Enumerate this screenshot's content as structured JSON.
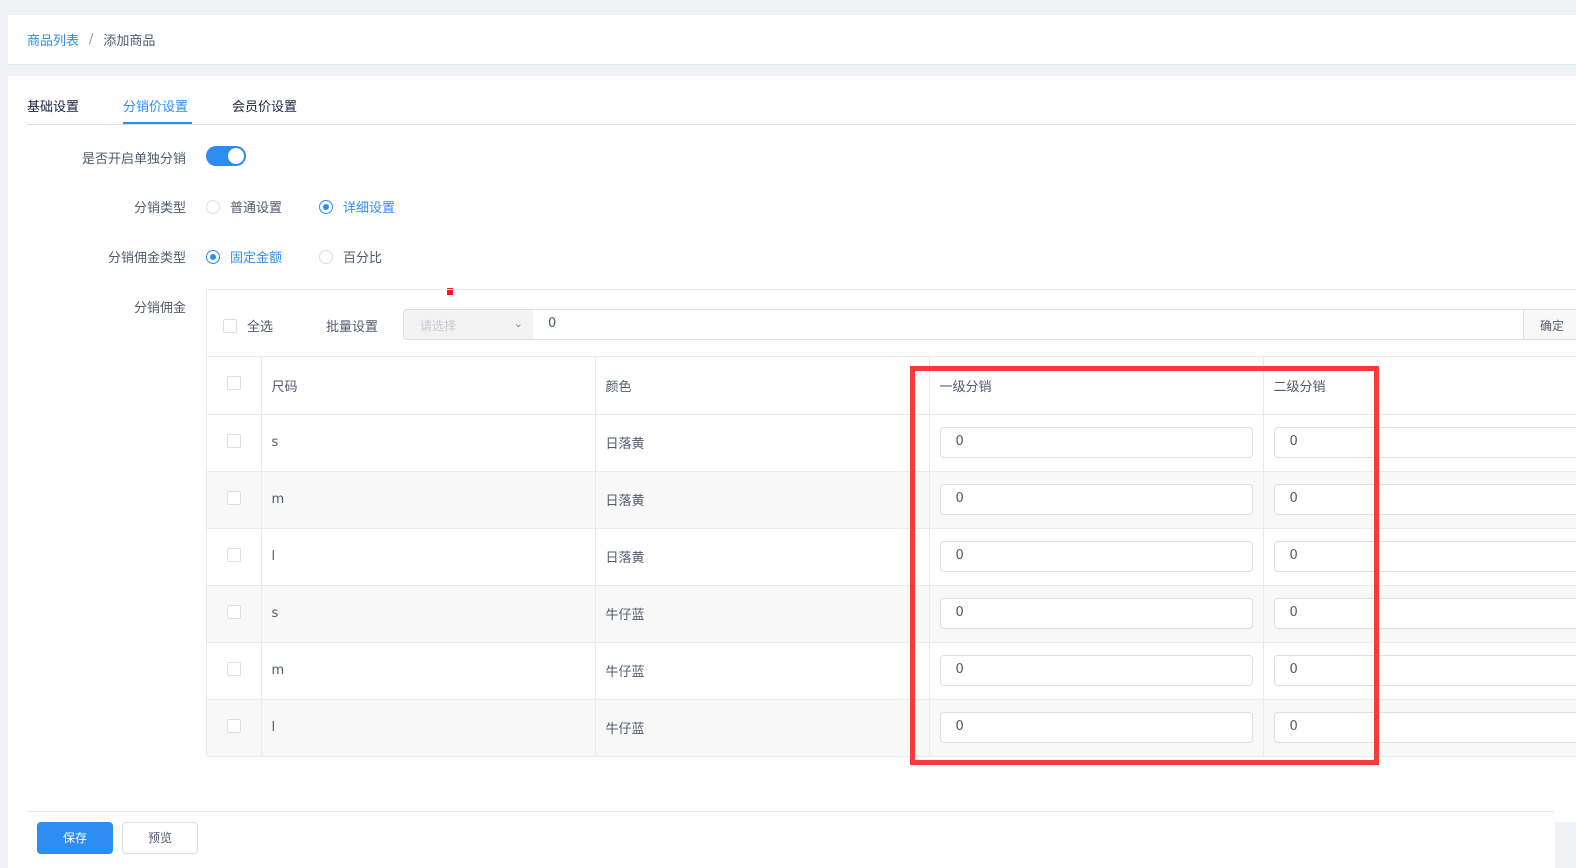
{
  "breadcrumb": {
    "parent": "商品列表",
    "separator": "/",
    "current": "添加商品"
  },
  "tabs": [
    {
      "label": "基础设置"
    },
    {
      "label": "分销价设置"
    },
    {
      "label": "会员价设置"
    }
  ],
  "active_tab": "分销价设置",
  "form": {
    "switch_label": "是否开启单独分销",
    "switch_on": true,
    "dist_type_label": "分销类型",
    "dist_type_options": [
      "普通设置",
      "详细设置"
    ],
    "dist_type_selected": "详细设置",
    "commission_type_label": "分销佣金类型",
    "commission_type_options": [
      "固定金额",
      "百分比"
    ],
    "commission_type_selected": "固定金额",
    "commission_label": "分销佣金"
  },
  "batch": {
    "select_all": "全选",
    "batch_label": "批量设置",
    "select_placeholder": "请选择",
    "value": "0",
    "confirm": "确定"
  },
  "table": {
    "headers": [
      "尺码",
      "颜色",
      "一级分销",
      "二级分销"
    ],
    "rows": [
      {
        "size": "s",
        "color": "日落黄",
        "level1": "0",
        "level2": "0"
      },
      {
        "size": "m",
        "color": "日落黄",
        "level1": "0",
        "level2": "0"
      },
      {
        "size": "l",
        "color": "日落黄",
        "level1": "0",
        "level2": "0"
      },
      {
        "size": "s",
        "color": "牛仔蓝",
        "level1": "0",
        "level2": "0"
      },
      {
        "size": "m",
        "color": "牛仔蓝",
        "level1": "0",
        "level2": "0"
      },
      {
        "size": "l",
        "color": "牛仔蓝",
        "level1": "0",
        "level2": "0"
      }
    ]
  },
  "footer": {
    "save": "保存",
    "preview": "预览"
  },
  "colors": {
    "primary": "#2d8cf0",
    "highlight": "#f23b3b"
  }
}
